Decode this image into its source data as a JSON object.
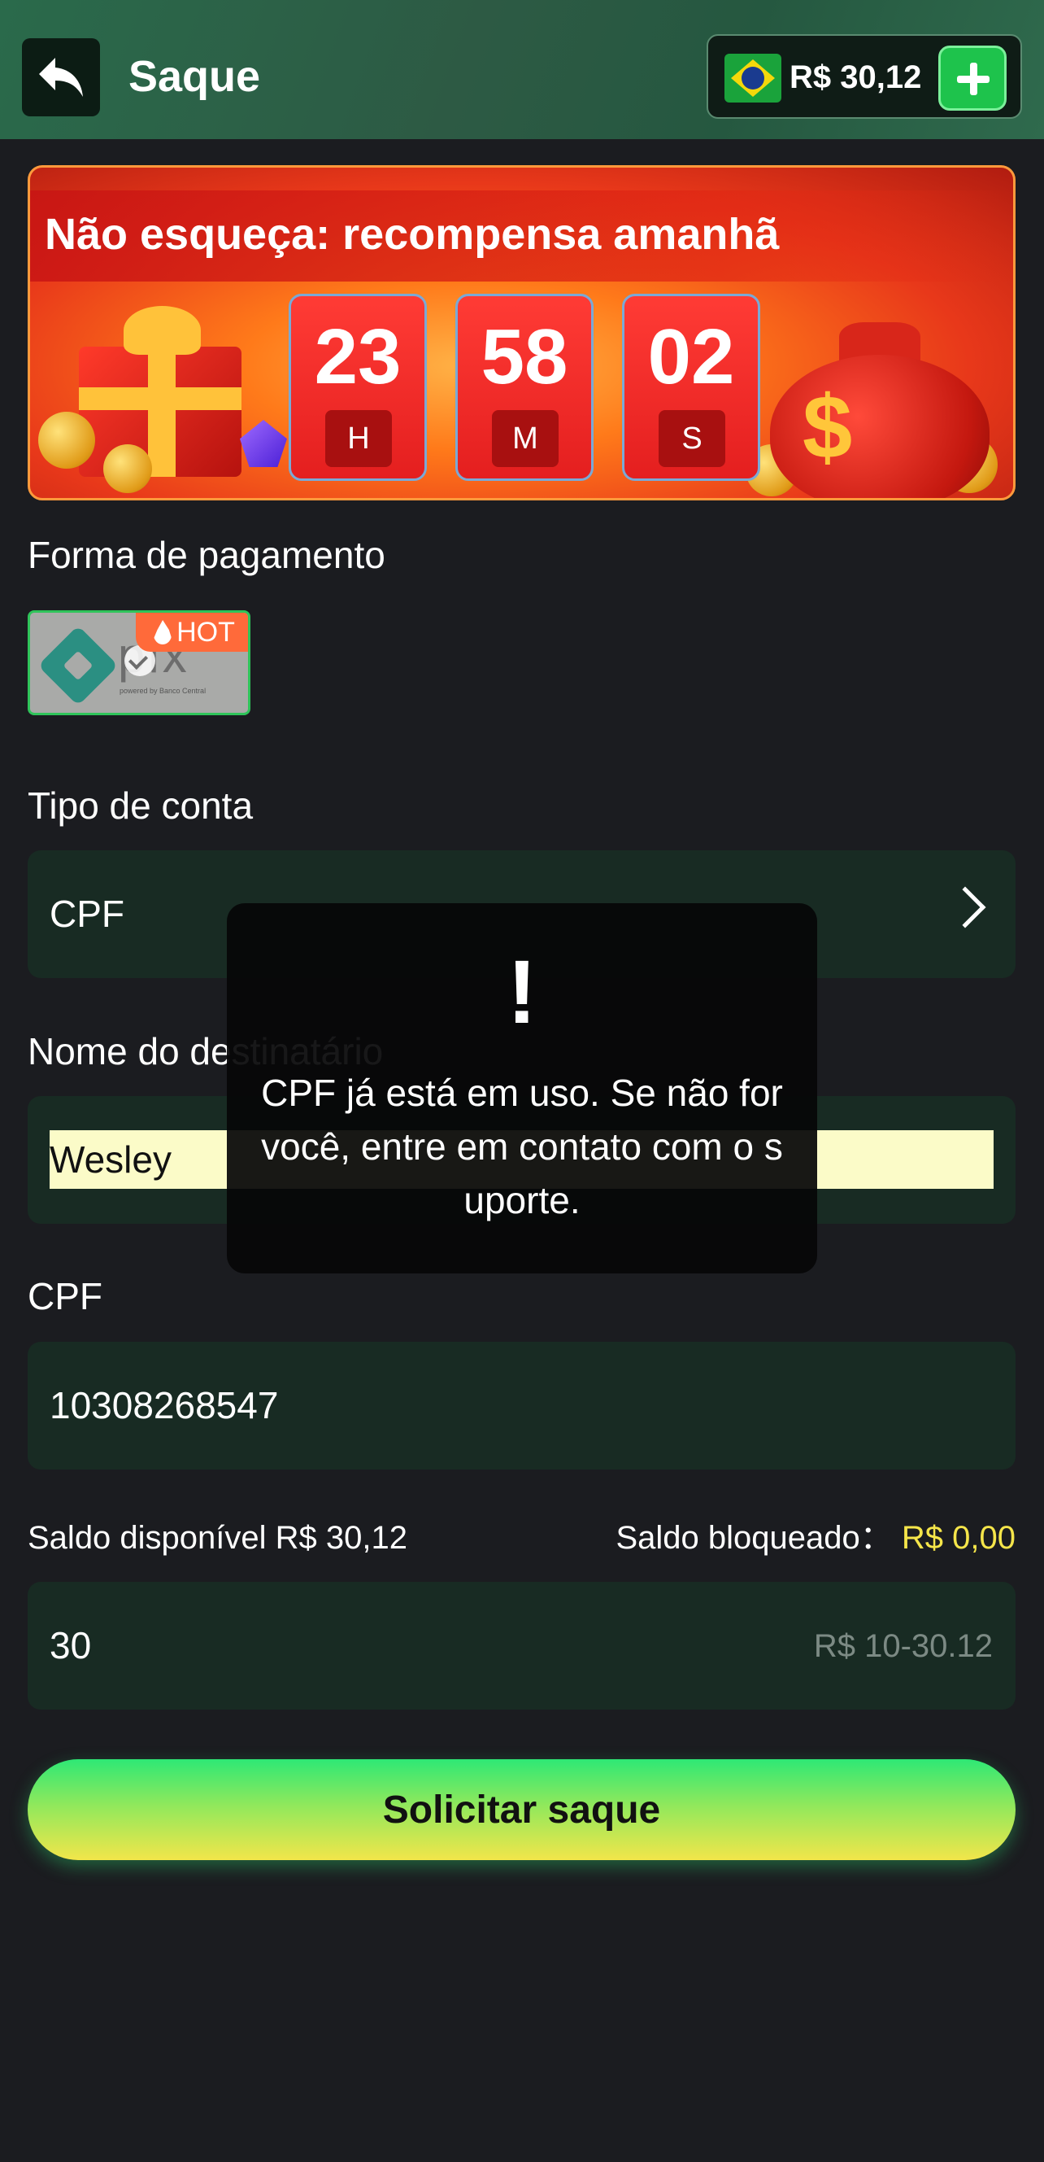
{
  "header": {
    "title": "Saque",
    "balance": "R$ 30,12"
  },
  "banner": {
    "title": "Não esqueça: recompensa amanhã",
    "timer": [
      {
        "value": "23",
        "unit": "H"
      },
      {
        "value": "58",
        "unit": "M"
      },
      {
        "value": "02",
        "unit": "S"
      }
    ]
  },
  "payment": {
    "label": "Forma de pagamento",
    "method_name": "pix",
    "method_sub": "powered by Banco Central",
    "hot_badge": "HOT"
  },
  "account_type": {
    "label": "Tipo de conta",
    "value": "CPF"
  },
  "recipient": {
    "label": "Nome do destinatário",
    "value": "Wesley"
  },
  "cpf": {
    "label": "CPF",
    "value": "10308268547"
  },
  "balances": {
    "available_label": "Saldo disponível",
    "available_value": "R$ 30,12",
    "blocked_label": "Saldo bloqueado：",
    "blocked_value": "R$ 0,00"
  },
  "amount": {
    "value": "30",
    "range_hint": "R$ 10-30.12"
  },
  "submit_label": "Solicitar saque",
  "toast": {
    "icon": "!",
    "message": "CPF já está em uso. Se não for você, entre em contato com o suporte."
  },
  "colors": {
    "header_bg": "#2d5a44",
    "field_bg": "#182b23",
    "accent_green": "#1ec34c",
    "blocked_yellow": "#f5e54a"
  }
}
